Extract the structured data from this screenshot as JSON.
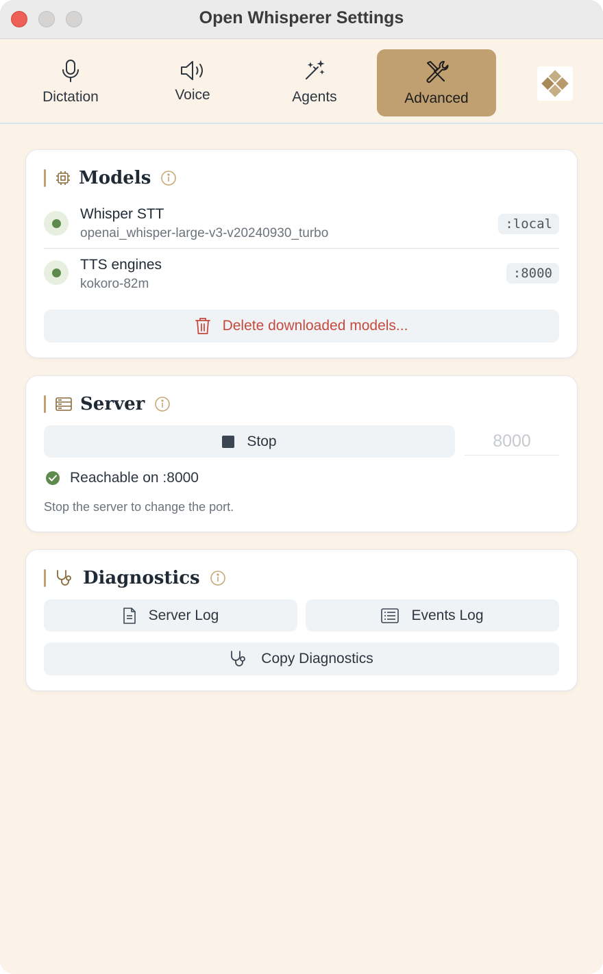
{
  "window": {
    "title": "Open Whisperer Settings"
  },
  "tabs": [
    {
      "label": "Dictation",
      "icon": "microphone-icon"
    },
    {
      "label": "Voice",
      "icon": "speaker-icon"
    },
    {
      "label": "Agents",
      "icon": "magic-wand-icon"
    },
    {
      "label": "Advanced",
      "icon": "tools-icon",
      "active": true
    }
  ],
  "models": {
    "title": "Models",
    "rows": [
      {
        "name": "Whisper STT",
        "detail": "openai_whisper-large-v3-v20240930_turbo",
        "badge": ":local",
        "status": "running"
      },
      {
        "name": "TTS engines",
        "detail": "kokoro-82m",
        "badge": ":8000",
        "status": "running"
      }
    ],
    "delete_label": "Delete downloaded models..."
  },
  "server": {
    "title": "Server",
    "stop_label": "Stop",
    "port_placeholder": "8000",
    "status_text": "Reachable on :8000",
    "note": "Stop the server to change the port."
  },
  "diagnostics": {
    "title": "Diagnostics",
    "server_log_label": "Server Log",
    "events_log_label": "Events Log",
    "copy_label": "Copy Diagnostics"
  },
  "colors": {
    "accent": "#c0a070",
    "background": "#fbf2e8",
    "status_ok": "#5e8a4e",
    "danger": "#c44a3e"
  }
}
